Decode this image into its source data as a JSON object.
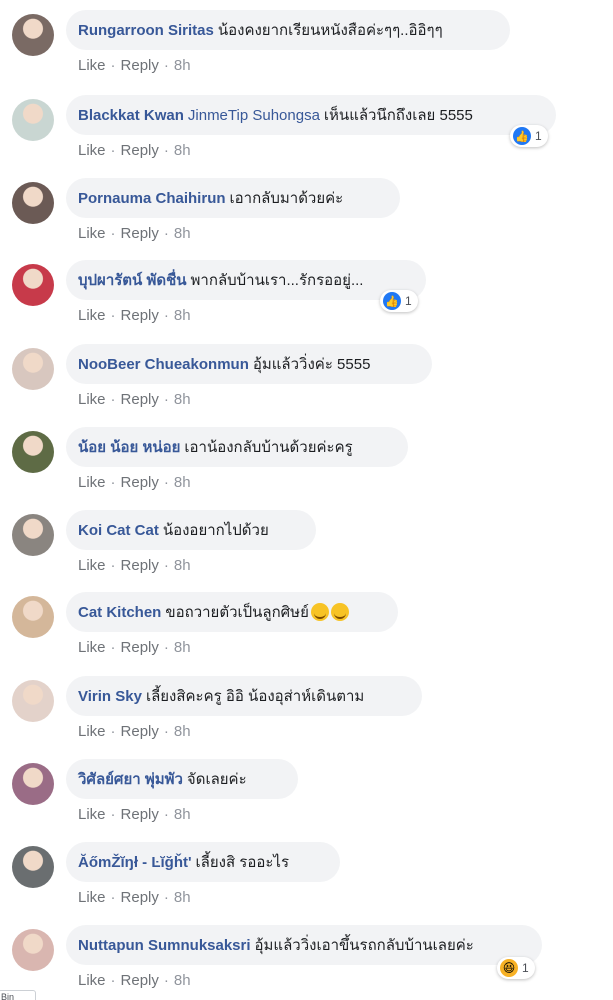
{
  "actions": {
    "like": "Like",
    "reply": "Reply",
    "separator": "·"
  },
  "comments": [
    {
      "author": "Rungarroon Siritas",
      "tag": "",
      "text": "น้องคงยากเรียนหนังสือค่ะๆๆ..อิอิๆๆ",
      "time": "8h",
      "avatar_color": "#7a6a64"
    },
    {
      "author": "Blackkat Kwan",
      "tag": "JinmeTip Suhongsa",
      "text": "เห็นแล้วนึกถึงเลย 5555",
      "time": "8h",
      "avatar_color": "#c9d6d2",
      "reaction": {
        "icon": "like-icon",
        "count": "1"
      }
    },
    {
      "author": "Pornauma Chaihirun",
      "tag": "",
      "text": "เอากลับมาด้วยค่ะ",
      "time": "8h",
      "avatar_color": "#6b5a55"
    },
    {
      "author": "บุปผารัตน์ พัดชื่น",
      "tag": "",
      "text": "พากลับบ้านเรา...รักรออยู่...",
      "time": "8h",
      "avatar_color": "#c73a4a",
      "reaction": {
        "icon": "like-icon",
        "count": "1"
      }
    },
    {
      "author": "NooBeer Chueakonmun",
      "tag": "",
      "text": "อุ้มแล้ววิ่งค่ะ 5555",
      "time": "8h",
      "avatar_color": "#d8c7bf"
    },
    {
      "author": "น้อย น้อย หน่อย",
      "tag": "",
      "text": "เอาน้องกลับบ้านด้วยค่ะครู",
      "time": "8h",
      "avatar_color": "#5e6b45"
    },
    {
      "author": "Koi Cat Cat",
      "tag": "",
      "text": "น้องอยากไปด้วย",
      "time": "8h",
      "avatar_color": "#8a8580"
    },
    {
      "author": "Cat Kitchen",
      "tag": "",
      "text": "ขอถวายตัวเป็นลูกศิษย์",
      "time": "8h",
      "avatar_color": "#d4b79a",
      "emoji_count": 2
    },
    {
      "author": "Virin Sky",
      "tag": "",
      "text": "เลี้ยงสิคะครู อิอิ น้องอุส่าห์เดินตาม",
      "time": "8h",
      "avatar_color": "#e3d2ca"
    },
    {
      "author": "วิศัลย์ศยา พุ่มพัว",
      "tag": "",
      "text": "จัดเลยค่ะ",
      "time": "8h",
      "avatar_color": "#9a6c86"
    },
    {
      "author": "ĂőmŽĭŋł - Ŀĭğȟt'",
      "tag": "",
      "text": "เลี้ยงสิ รออะไร",
      "time": "8h",
      "avatar_color": "#6a6e70"
    },
    {
      "author": "Nuttapun Sumnuksaksri",
      "tag": "",
      "text": "อุ้มแล้ววิ่งเอาขึ้นรถกลับบ้านเลยค่ะ",
      "time": "8h",
      "avatar_color": "#d9b6b0",
      "reaction": {
        "icon": "haha-icon",
        "count": "1"
      }
    }
  ],
  "corner_label": "Bin"
}
